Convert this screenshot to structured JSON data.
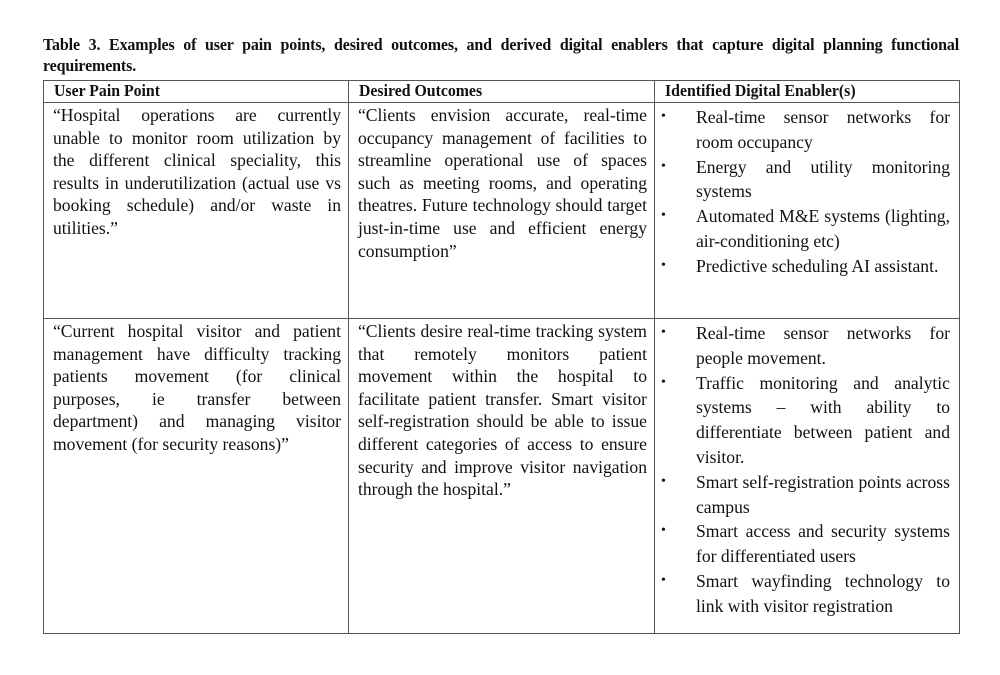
{
  "caption": "Table 3. Examples of user pain points, desired outcomes, and derived digital enablers that capture digital planning functional requirements.",
  "table": {
    "headers": [
      "User Pain Point",
      "Desired Outcomes",
      "Identified Digital Enabler(s)"
    ],
    "rows": [
      {
        "pain_point": "“Hospital operations are currently unable to monitor room utilization by the different clinical speciality, this results in underutilization (actual use vs booking schedule) and/or waste in utilities.”",
        "desired_outcome": "“Clients envision accurate, real-time occupancy management of facilities to streamline operational use of spaces such as meeting rooms, and operating theatres. Future technology should target just-in-time use and efficient energy consumption”",
        "enablers": [
          "Real-time sensor networks for room occupancy",
          "Energy and utility monitoring systems",
          "Automated M&E systems (lighting, air-conditioning etc)",
          "Predictive scheduling AI assistant."
        ]
      },
      {
        "pain_point": "“Current hospital visitor and patient management have difficulty tracking patients movement (for clinical purposes, ie transfer between department) and managing visitor movement (for security reasons)”",
        "desired_outcome": "“Clients desire real-time tracking system that remotely monitors patient movement within the hospital to facilitate patient transfer. Smart visitor self-registration should be able to issue different categories of access to ensure security and improve visitor navigation through the hospital.”",
        "enablers": [
          "Real-time sensor networks for people movement.",
          "Traffic monitoring and analytic systems – with ability to differentiate between patient and visitor.",
          "Smart self-registration points across campus",
          "Smart access and security systems for differentiated users",
          "Smart wayfinding technology to link with visitor registration"
        ]
      }
    ]
  },
  "icons": {
    "bullet": "•"
  }
}
